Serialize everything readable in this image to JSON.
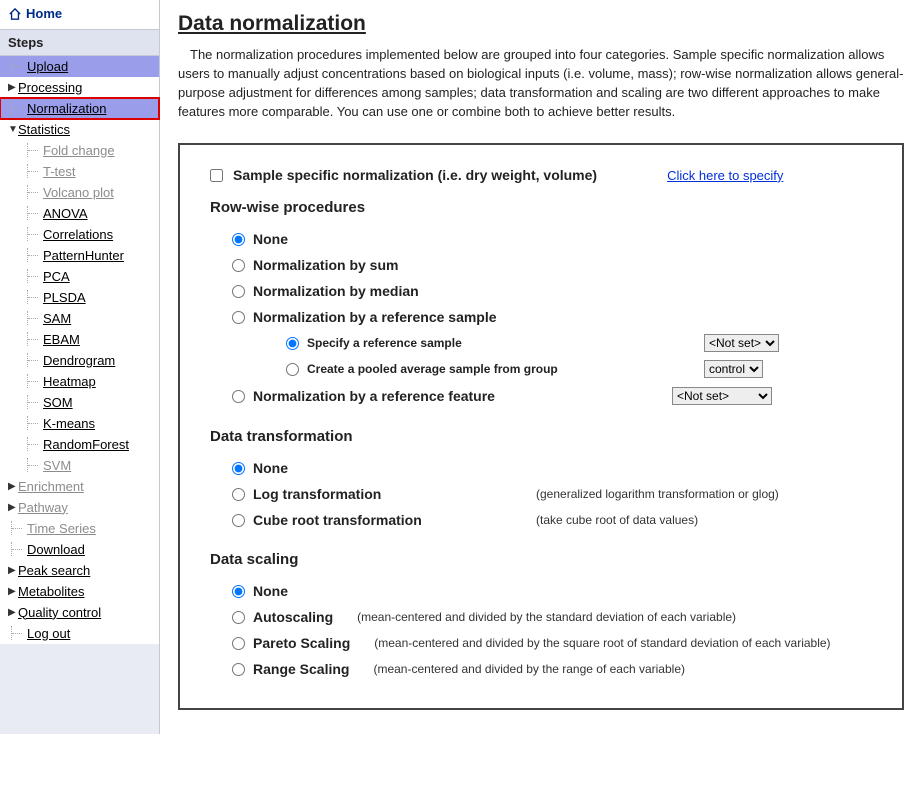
{
  "home": "Home",
  "steps_header": "Steps",
  "nav": {
    "upload": "Upload",
    "processing": "Processing",
    "normalization": "Normalization",
    "statistics": "Statistics",
    "stats_items": {
      "fold_change": "Fold change",
      "t_test": "T-test",
      "volcano": "Volcano plot",
      "anova": "ANOVA",
      "correlations": "Correlations",
      "patternhunter": "PatternHunter",
      "pca": "PCA",
      "plsda": "PLSDA",
      "sam": "SAM",
      "ebam": "EBAM",
      "dendrogram": "Dendrogram",
      "heatmap": "Heatmap",
      "som": "SOM",
      "kmeans": "K-means",
      "randomforest": "RandomForest",
      "svm": "SVM"
    },
    "enrichment": "Enrichment",
    "pathway": "Pathway",
    "timeseries": "Time Series",
    "download": "Download",
    "peaksearch": "Peak search",
    "metabolites": "Metabolites",
    "qualitycontrol": "Quality control",
    "logout": "Log out"
  },
  "page": {
    "title": "Data normalization",
    "intro": "The normalization procedures implemented below are grouped into four categories. Sample specific normalization allows users to manually adjust concentrations based on biological inputs (i.e. volume, mass); row-wise normalization allows general-purpose adjustment for differences among samples; data transformation and scaling are two different approaches to make features more comparable. You can use one or combine both to achieve better results."
  },
  "sample_specific": {
    "label": "Sample specific normalization (i.e. dry weight, volume)",
    "link": "Click here to specify"
  },
  "rowwise": {
    "title": "Row-wise procedures",
    "none": "None",
    "by_sum": "Normalization by sum",
    "by_median": "Normalization by median",
    "by_ref_sample": "Normalization by a reference sample",
    "specify_ref": "Specify a reference sample",
    "pooled_avg": "Create a pooled average sample from group",
    "by_ref_feature": "Normalization by a reference feature",
    "not_set": "<Not set>",
    "control": "control"
  },
  "transform": {
    "title": "Data transformation",
    "none": "None",
    "log": "Log transformation",
    "log_hint": "(generalized logarithm transformation or glog)",
    "cube": "Cube root transformation",
    "cube_hint": "(take cube root of data values)"
  },
  "scaling": {
    "title": "Data scaling",
    "none": "None",
    "auto": "Autoscaling",
    "auto_hint": "(mean-centered and divided by the standard deviation of each variable)",
    "pareto": "Pareto Scaling",
    "pareto_hint": "(mean-centered and divided by the square root of standard deviation of each variable)",
    "range": "Range Scaling",
    "range_hint": "(mean-centered and divided by the range of each variable)"
  }
}
